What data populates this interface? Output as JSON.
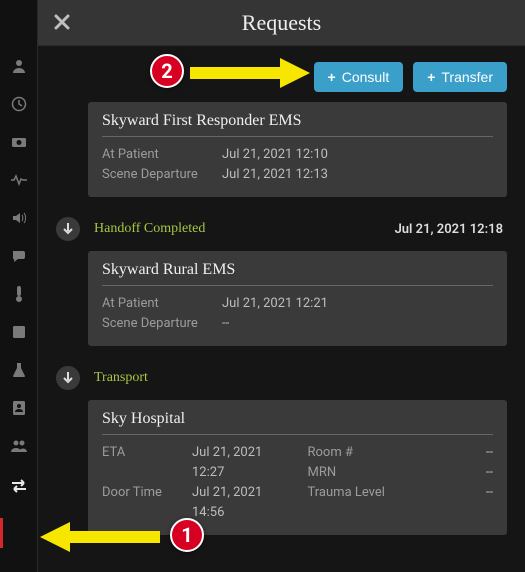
{
  "title": "Requests",
  "toolbar": {
    "consult_label": "Consult",
    "transfer_label": "Transfer"
  },
  "sidebar": {
    "items": [
      {
        "name": "user-icon"
      },
      {
        "name": "clock-icon"
      },
      {
        "name": "camera-icon"
      },
      {
        "name": "heartbeat-icon"
      },
      {
        "name": "volume-icon"
      },
      {
        "name": "chat-icon"
      },
      {
        "name": "thermometer-icon"
      },
      {
        "name": "note-icon"
      },
      {
        "name": "flask-icon"
      },
      {
        "name": "contact-icon"
      },
      {
        "name": "group-icon"
      },
      {
        "name": "transfer-icon"
      }
    ]
  },
  "cards": [
    {
      "title": "Skyward First Responder EMS",
      "rows": [
        {
          "label": "At Patient",
          "value": "Jul 21, 2021 12:10"
        },
        {
          "label": "Scene Departure",
          "value": "Jul 21, 2021 12:13"
        }
      ]
    },
    {
      "title": "Skyward Rural EMS",
      "rows": [
        {
          "label": "At Patient",
          "value": "Jul 21, 2021 12:21"
        },
        {
          "label": "Scene Departure",
          "value": "--"
        }
      ]
    },
    {
      "title": "Sky Hospital",
      "left": [
        {
          "label": "ETA",
          "value": "Jul 21, 2021 12:27"
        },
        {
          "label": "Door Time",
          "value": "Jul 21, 2021 14:56"
        }
      ],
      "right": [
        {
          "label": "Room #",
          "value": "--"
        },
        {
          "label": "MRN",
          "value": "--"
        },
        {
          "label": "Trauma Level",
          "value": "--"
        }
      ]
    }
  ],
  "statuses": [
    {
      "text": "Handoff Completed",
      "time": "Jul 21, 2021 12:18"
    },
    {
      "text": "Transport",
      "time": ""
    }
  ],
  "annotations": {
    "callout1": "1",
    "callout2": "2"
  }
}
